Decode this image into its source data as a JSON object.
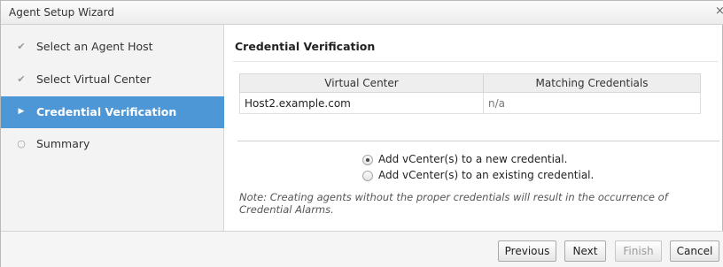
{
  "window": {
    "title": "Agent Setup Wizard",
    "close_glyph": "×"
  },
  "steps": [
    {
      "label": "Select an Agent Host",
      "state": "done",
      "mark": "✔"
    },
    {
      "label": "Select Virtual Center",
      "state": "done",
      "mark": "✔"
    },
    {
      "label": "Credential Verification",
      "state": "active",
      "mark": "▶"
    },
    {
      "label": "Summary",
      "state": "pending",
      "mark": "○"
    }
  ],
  "main": {
    "title": "Credential Verification",
    "table": {
      "columns": [
        "Virtual Center",
        "Matching Credentials"
      ],
      "rows": [
        [
          "Host2.example.com",
          "n/a"
        ]
      ]
    },
    "options": [
      {
        "label": "Add vCenter(s) to a new credential.",
        "checked": true
      },
      {
        "label": "Add vCenter(s) to an existing credential.",
        "checked": false
      }
    ],
    "note": "Note: Creating agents without the proper credentials will result in the occurrence of Credential Alarms."
  },
  "buttons": {
    "previous": "Previous",
    "next": "Next",
    "finish": "Finish",
    "cancel": "Cancel"
  },
  "colors": {
    "active_step": "#4d97d6"
  }
}
